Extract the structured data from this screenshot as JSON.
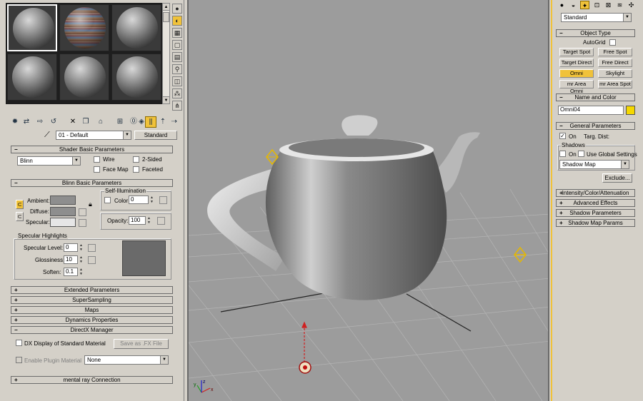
{
  "material_editor": {
    "material_name": "01 - Default",
    "material_type_button": "Standard",
    "shader_basic": {
      "title": "Shader Basic Parameters",
      "shader": "Blinn",
      "wire": "Wire",
      "two_sided": "2-Sided",
      "face_map": "Face Map",
      "faceted": "Faceted"
    },
    "blinn_basic": {
      "title": "Blinn Basic Parameters",
      "ambient": "Ambient:",
      "diffuse": "Diffuse:",
      "specular": "Specular:",
      "self_illum_title": "Self-Illumination",
      "color_label": "Color",
      "color_value": "0",
      "opacity_label": "Opacity:",
      "opacity_value": "100",
      "lock_icon": "lock-icon"
    },
    "specular_highlights": {
      "title": "Specular Highlights",
      "level_label": "Specular Level:",
      "level_value": "0",
      "gloss_label": "Glossiness:",
      "gloss_value": "10",
      "soften_label": "Soften:",
      "soften_value": "0.1"
    },
    "rollouts": [
      "Extended Parameters",
      "SuperSampling",
      "Maps",
      "Dynamics Properties",
      "DirectX Manager"
    ],
    "directx": {
      "dx_display": "DX Display of Standard Material",
      "save_fx": "Save as .FX File",
      "enable_plugin": "Enable Plugin Material",
      "plugin_value": "None"
    },
    "mental_ray": "mental ray Connection",
    "colors": {
      "ambient": "#8e8e8e",
      "diffuse": "#8e8e8e",
      "specular": "#e6e6e6",
      "highlight_preview": "#6a6a6a",
      "accent": "#f0c23a"
    }
  },
  "command_panel": {
    "category": "Standard",
    "object_type_title": "Object Type",
    "autogrid": "AutoGrid",
    "object_buttons": [
      "Target Spot",
      "Free Spot",
      "Target Direct",
      "Free Direct",
      "Omni",
      "Skylight",
      "mr Area Omni",
      "mr Area Spot"
    ],
    "active_object": "Omni",
    "name_color_title": "Name and Color",
    "object_name": "Omni04",
    "object_color": "#f5d800",
    "general_title": "General Parameters",
    "on_label": "On",
    "targ_dist": "Targ. Dist:",
    "shadows_title": "Shadows",
    "shadows_on": "On",
    "use_global": "Use Global Settings",
    "shadow_type": "Shadow Map",
    "exclude": "Exclude...",
    "rollouts": [
      "Intensity/Color/Attenuation",
      "Advanced Effects",
      "Shadow Parameters",
      "Shadow Map Params"
    ]
  },
  "viewport": {
    "axis_labels": [
      "x",
      "y",
      "z"
    ]
  }
}
